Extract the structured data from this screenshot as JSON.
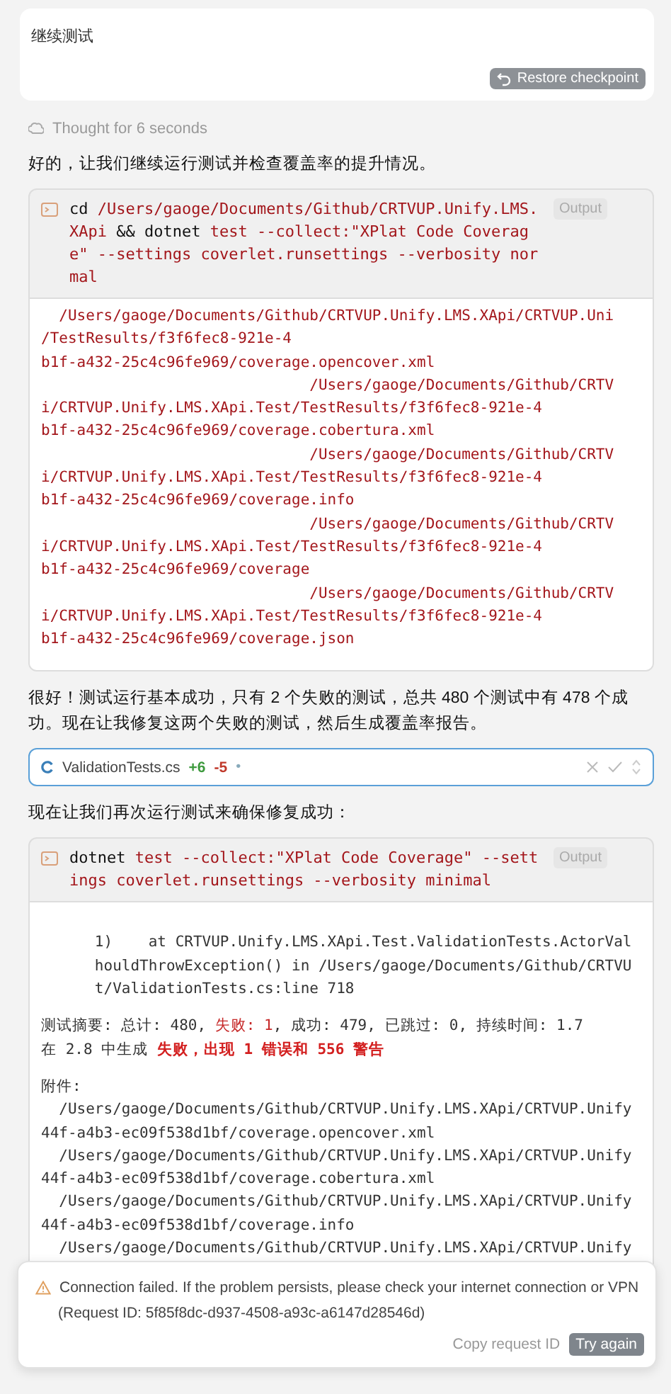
{
  "user_message": {
    "text": "继续测试",
    "restore_button": "Restore checkpoint"
  },
  "thought": "Thought for 6 seconds",
  "messages": [
    {
      "kind": "text",
      "text": "好的，让我们继续运行测试并检查覆盖率的提升情况。"
    },
    {
      "kind": "terminal",
      "output_label": "Output",
      "command": [
        {
          "text": "cd ",
          "kind": "plain"
        },
        {
          "text": "/Users/gaoge/Documents/Github/CRTVUP.Unify.LMS.XApi",
          "kind": "arg"
        },
        {
          "text": " && dotnet ",
          "kind": "plain"
        },
        {
          "text": "test --collect:\"XPlat Code Coverage\" --settings coverlet.runsettings --verbosity normal",
          "kind": "arg"
        }
      ],
      "groups": [
        [
          [
            {
              "text": "  /Users/gaoge/Documents/Github/CRTVUP.Unify.LMS.XApi/CRTVUP.Uni",
              "kind": "path"
            }
          ],
          [
            {
              "text": "/TestResults/f3f6fec8-921e-4",
              "kind": "path"
            }
          ],
          [
            {
              "text": "b1f-a432-25c4c96fe969/coverage.opencover.xml",
              "kind": "path"
            }
          ],
          [
            {
              "text": "                              /Users/gaoge/Documents/Github/CRTV",
              "kind": "path"
            }
          ],
          [
            {
              "text": "i/CRTVUP.Unify.LMS.XApi.Test/TestResults/f3f6fec8-921e-4",
              "kind": "path"
            }
          ],
          [
            {
              "text": "b1f-a432-25c4c96fe969/coverage.cobertura.xml",
              "kind": "path"
            }
          ],
          [
            {
              "text": "                              /Users/gaoge/Documents/Github/CRTV",
              "kind": "path"
            }
          ],
          [
            {
              "text": "i/CRTVUP.Unify.LMS.XApi.Test/TestResults/f3f6fec8-921e-4",
              "kind": "path"
            }
          ],
          [
            {
              "text": "b1f-a432-25c4c96fe969/coverage.info",
              "kind": "path"
            }
          ],
          [
            {
              "text": "                              /Users/gaoge/Documents/Github/CRTV",
              "kind": "path"
            }
          ],
          [
            {
              "text": "i/CRTVUP.Unify.LMS.XApi.Test/TestResults/f3f6fec8-921e-4",
              "kind": "path"
            }
          ],
          [
            {
              "text": "b1f-a432-25c4c96fe969/coverage",
              "kind": "path"
            }
          ],
          [
            {
              "text": "                              /Users/gaoge/Documents/Github/CRTV",
              "kind": "path"
            }
          ],
          [
            {
              "text": "i/CRTVUP.Unify.LMS.XApi.Test/TestResults/f3f6fec8-921e-4",
              "kind": "path"
            }
          ],
          [
            {
              "text": "b1f-a432-25c4c96fe969/coverage.json",
              "kind": "path"
            }
          ]
        ]
      ]
    },
    {
      "kind": "text",
      "text": "很好！测试运行基本成功，只有 2 个失败的测试，总共 480 个测试中有 478 个成功。现在让我修复这两个失败的测试，然后生成覆盖率报告。"
    },
    {
      "kind": "edit",
      "file": "ValidationTests.cs",
      "added": "+6",
      "removed": "-5",
      "status": "•"
    },
    {
      "kind": "text",
      "text": "现在让我们再次运行测试来确保修复成功："
    },
    {
      "kind": "terminal",
      "output_label": "Output",
      "command": [
        {
          "text": "dotnet ",
          "kind": "plain"
        },
        {
          "text": "test --collect:\"XPlat Code Coverage\" --settings coverlet.runsettings --verbosity minimal",
          "kind": "arg"
        }
      ],
      "groups": [
        [
          [
            {
              "text": "      1)    at CRTVUP.Unify.LMS.XApi.Test.ValidationTests.ActorVal",
              "kind": "plain"
            }
          ],
          [
            {
              "text": "      houldThrowException() in /Users/gaoge/Documents/Github/CRTVU",
              "kind": "plain"
            }
          ],
          [
            {
              "text": "      t/ValidationTests.cs:line 718",
              "kind": "plain"
            }
          ]
        ],
        [
          [
            {
              "text": "测试摘要: 总计: 480, ",
              "kind": "plain"
            },
            {
              "text": "失败: 1",
              "kind": "warn"
            },
            {
              "text": ", 成功: 479, 已跳过: 0, 持续时间: 1.7",
              "kind": "plain"
            }
          ],
          [
            {
              "text": "在 2.8 中生成 ",
              "kind": "plain"
            },
            {
              "text": "失败，出现 1 错误和 556 警告",
              "kind": "error"
            }
          ]
        ],
        [
          [
            {
              "text": "附件:",
              "kind": "plain"
            }
          ],
          [
            {
              "text": "  /Users/gaoge/Documents/Github/CRTVUP.Unify.LMS.XApi/CRTVUP.Unify",
              "kind": "plain"
            }
          ],
          [
            {
              "text": "44f-a4b3-ec09f538d1bf/coverage.opencover.xml",
              "kind": "plain"
            }
          ],
          [
            {
              "text": "  /Users/gaoge/Documents/Github/CRTVUP.Unify.LMS.XApi/CRTVUP.Unify",
              "kind": "plain"
            }
          ],
          [
            {
              "text": "44f-a4b3-ec09f538d1bf/coverage.cobertura.xml",
              "kind": "plain"
            }
          ],
          [
            {
              "text": "  /Users/gaoge/Documents/Github/CRTVUP.Unify.LMS.XApi/CRTVUP.Unify",
              "kind": "plain"
            }
          ],
          [
            {
              "text": "44f-a4b3-ec09f538d1bf/coverage.info",
              "kind": "plain"
            }
          ],
          [
            {
              "text": "  /Users/gaoge/Documents/Github/CRTVUP.Unify.LMS.XApi/CRTVUP.Unify",
              "kind": "plain"
            }
          ]
        ]
      ]
    }
  ],
  "toast": {
    "message": "Connection failed. If the problem persists, please check your internet connection or VPN",
    "request_id": "(Request ID: 5f85f8dc-d937-4508-a93c-a6147d28546d)",
    "copy_link": "Copy request ID",
    "retry_button": "Try again"
  }
}
